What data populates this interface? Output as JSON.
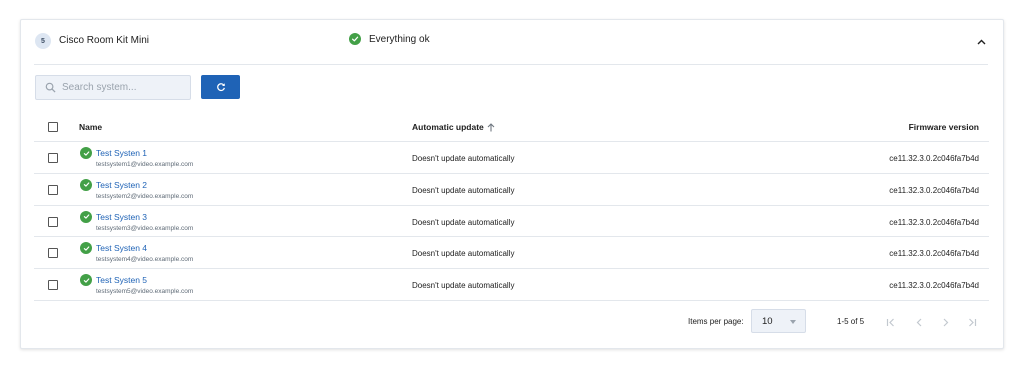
{
  "group": {
    "count": "5",
    "name": "Cisco Room Kit Mini",
    "status_text": "Everything ok"
  },
  "search": {
    "placeholder": "Search system..."
  },
  "table": {
    "columns": {
      "name": "Name",
      "auto": "Automatic update",
      "firmware": "Firmware version"
    },
    "rows": [
      {
        "name": "Test Systen 1",
        "email": "testsystem1@video.example.com",
        "auto": "Doesn't update automatically",
        "firmware": "ce11.32.3.0.2c046fa7b4d"
      },
      {
        "name": "Test Systen 2",
        "email": "testsystem2@video.example.com",
        "auto": "Doesn't update automatically",
        "firmware": "ce11.32.3.0.2c046fa7b4d"
      },
      {
        "name": "Test Systen 3",
        "email": "testsystem3@video.example.com",
        "auto": "Doesn't update automatically",
        "firmware": "ce11.32.3.0.2c046fa7b4d"
      },
      {
        "name": "Test Systen 4",
        "email": "testsystem4@video.example.com",
        "auto": "Doesn't update automatically",
        "firmware": "ce11.32.3.0.2c046fa7b4d"
      },
      {
        "name": "Test Systen 5",
        "email": "testsystem5@video.example.com",
        "auto": "Doesn't update automatically",
        "firmware": "ce11.32.3.0.2c046fa7b4d"
      }
    ]
  },
  "pager": {
    "items_per_page_label": "Items per page:",
    "items_per_page": "10",
    "range": "1-5 of 5"
  },
  "icons": {
    "status": "check-circle-icon",
    "collapse": "chevron-up-icon",
    "search": "search-icon",
    "refresh": "refresh-icon",
    "sort": "arrow-up-icon"
  },
  "colors": {
    "accent": "#1f63b6",
    "success": "#43a047",
    "border": "#e3e7ec",
    "input_bg": "#eef2f8"
  }
}
